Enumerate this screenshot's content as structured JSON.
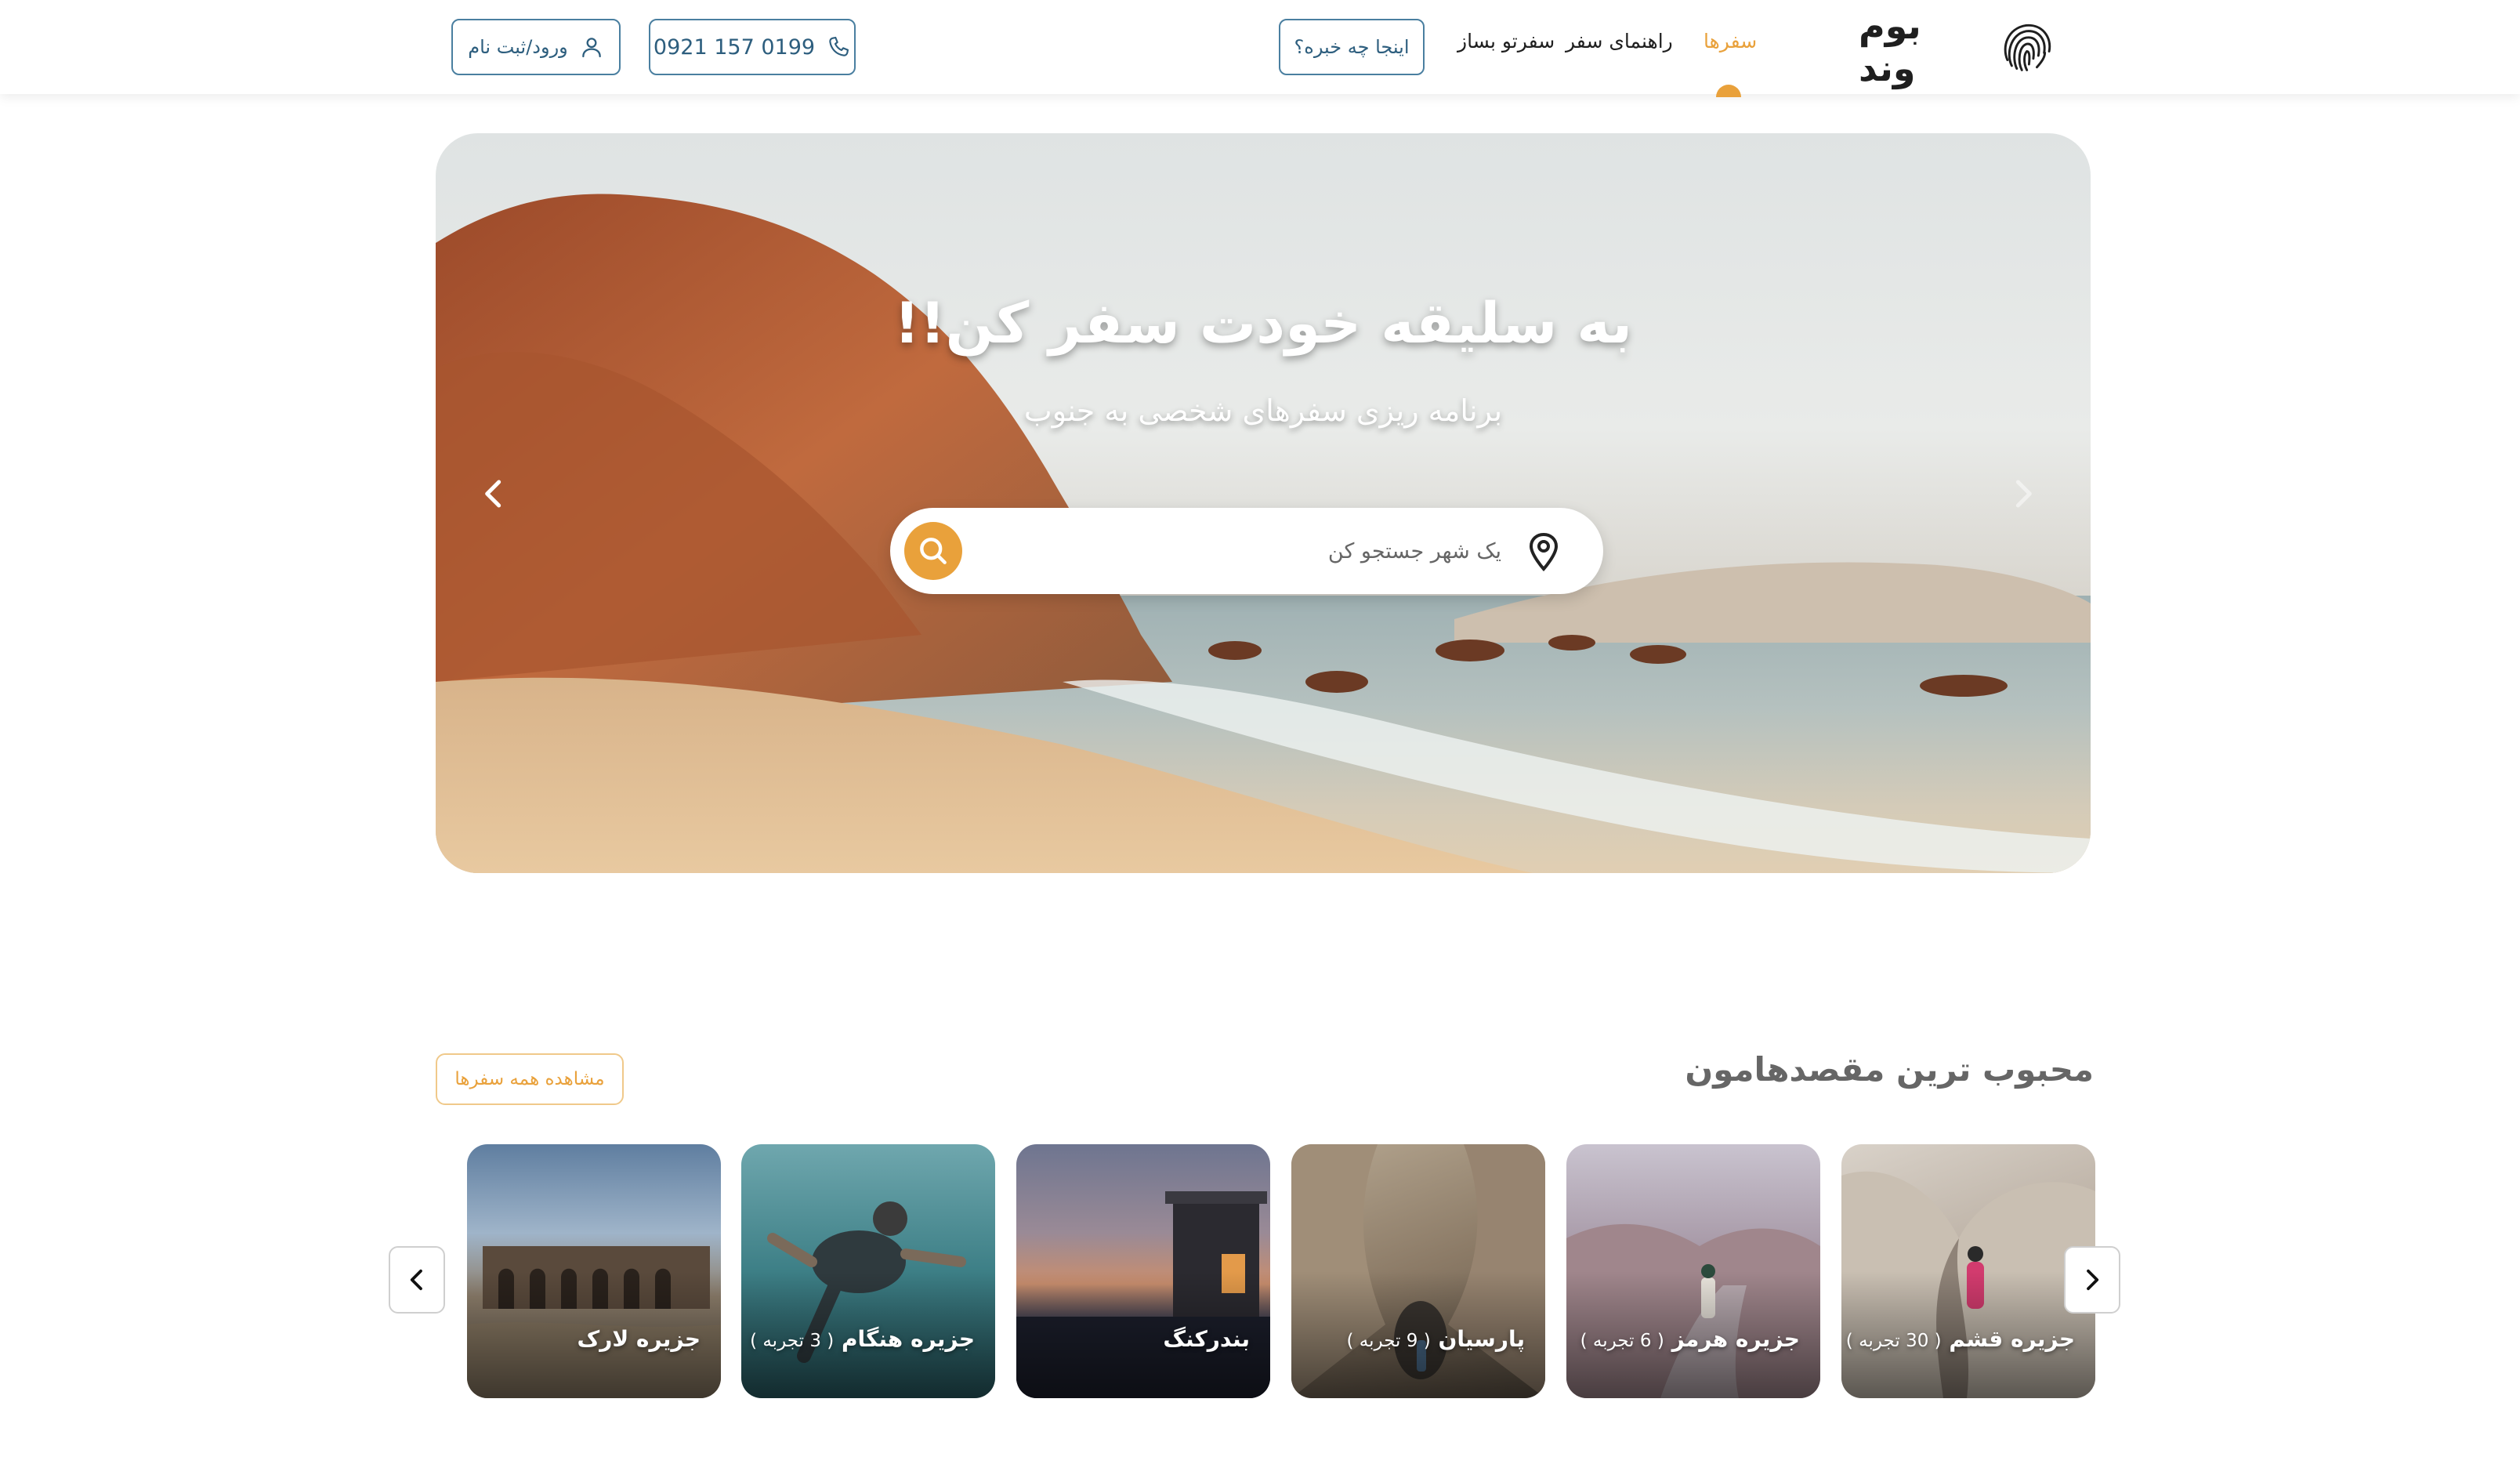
{
  "header": {
    "logo_text": "بوم وند",
    "nav": {
      "trips": "سفرها",
      "travel_guide": "راهنمای سفر",
      "build_trip": "سفرتو بساز",
      "whats_up": "اینجا چه خبره؟"
    },
    "phone": "0921 157 0199",
    "login_label": "ورود/ثبت نام"
  },
  "hero": {
    "title": "به سلیقه خودت سفر کن!!",
    "subtitle": "برنامه ریزی سفرهای شخصی به جنوب",
    "search_placeholder": "یک شهر جستجو کن"
  },
  "destinations": {
    "title": "محبوب ترین مقصدهامون",
    "view_all_label": "مشاهده همه سفرها",
    "cards": [
      {
        "name": "جزیره قشم",
        "count": "( 30 تجربه )"
      },
      {
        "name": "جزیره هرمز",
        "count": "( 6 تجربه )"
      },
      {
        "name": "پارسیان",
        "count": "( 9 تجربه )"
      },
      {
        "name": "بندرکنگ",
        "count": ""
      },
      {
        "name": "جزیره هنگام",
        "count": "( 3 تجربه )"
      },
      {
        "name": "جزیره لارک",
        "count": ""
      }
    ]
  },
  "colors": {
    "accent": "#E9A13B",
    "outline_blue": "#4A7FA0"
  }
}
